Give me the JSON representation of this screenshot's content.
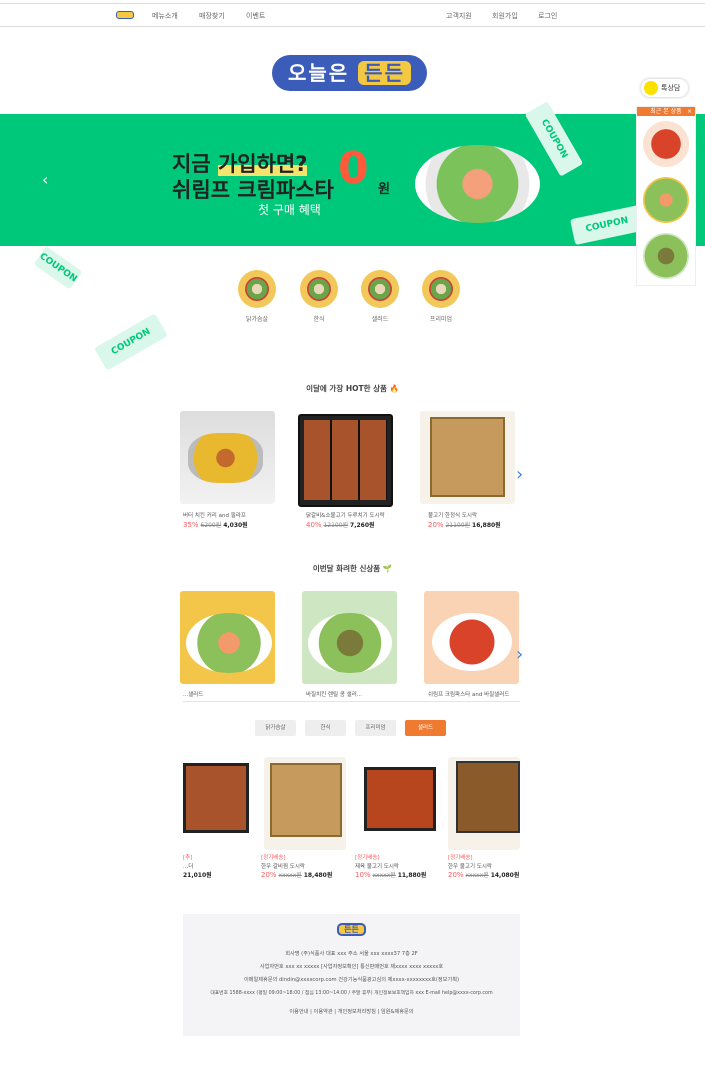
{
  "nav": {
    "left": [
      "메뉴소개",
      "매장찾기",
      "이벤트"
    ],
    "right": [
      "고객지원",
      "회원가입",
      "로그인"
    ]
  },
  "logo": {
    "text": "오늘은",
    "highlight": "든든"
  },
  "banner": {
    "line1_a": "지금 ",
    "line1_b": "가입하면?",
    "line2": "쉬림프 크림파스타",
    "zero": "0",
    "won": "원",
    "line3": "첫 구매 혜택",
    "coupon": "COUPON"
  },
  "categories": [
    "닭가슴살",
    "한식",
    "샐러드",
    "프리미엄"
  ],
  "hot": {
    "title": "이달에 가장 HOT한 상품 🔥",
    "items": [
      {
        "name": "버터 치킨 커리 and 필라프",
        "discount": "35%",
        "original": "6200원",
        "price": "4,030원"
      },
      {
        "name": "닭갈비&소불고기 두루치기 도시락",
        "discount": "40%",
        "original": "12100원",
        "price": "7,260원"
      },
      {
        "name": "불고기 한정식 도시락",
        "discount": "20%",
        "original": "21100원",
        "price": "16,880원"
      }
    ]
  },
  "fresh": {
    "title": "이번달 화려한 신상품 🌱",
    "items": [
      {
        "name": "...샐러드"
      },
      {
        "name": "바질치킨 렌틸 콩 샐러..."
      },
      {
        "name": "쉬림프 크림파스타 and 바질샐러드"
      }
    ]
  },
  "tabs": [
    "닭가슴살",
    "한식",
    "프리미엄",
    "샐러드"
  ],
  "tab_active": 3,
  "bento": {
    "items": [
      {
        "tag": "[추]",
        "name": "...더",
        "original": "",
        "price": "21,010원"
      },
      {
        "tag": "[정기배송]",
        "name": "한우 갈비찜 도시락",
        "discount": "20%",
        "original": "xxxxx원",
        "price": "18,480원"
      },
      {
        "tag": "[정기배송]",
        "name": "제육 불고기 도시락",
        "discount": "10%",
        "original": "xxxxx원",
        "price": "11,880원"
      },
      {
        "tag": "[정기배송]",
        "name": "한우 불고기 도시락",
        "discount": "20%",
        "original": "xxxxx원",
        "price": "14,080원"
      }
    ]
  },
  "footer": {
    "logo": "든든",
    "lines": [
      "회사명 (주)식품사 대표 xxx 주소 서울 xxx xxxx37 7층 2F",
      "사업자번호 xxx xx xxxxx [사업자정보확인] 통신판매번호 제xxxx xxxx xxxxx호",
      "이메일제휴문의 dindin@xxxxcorp.com 건강기능식품광고심의 제xxxx-xxxxxxxx호(정보기획)",
      "대표번호 1588-xxxx (평일 09:00~18:00 / 점심 13:00~14:00 / 주말 휴무) 개인정보보호책임자 xxx E-mail help@xxxx-corp.com"
    ],
    "links": "이용안내 | 이용약관 | 개인정보처리방침 | 임원&제휴문의"
  },
  "side": {
    "talk": "톡상담",
    "recent": "최근 본 상품",
    "close": "×"
  }
}
